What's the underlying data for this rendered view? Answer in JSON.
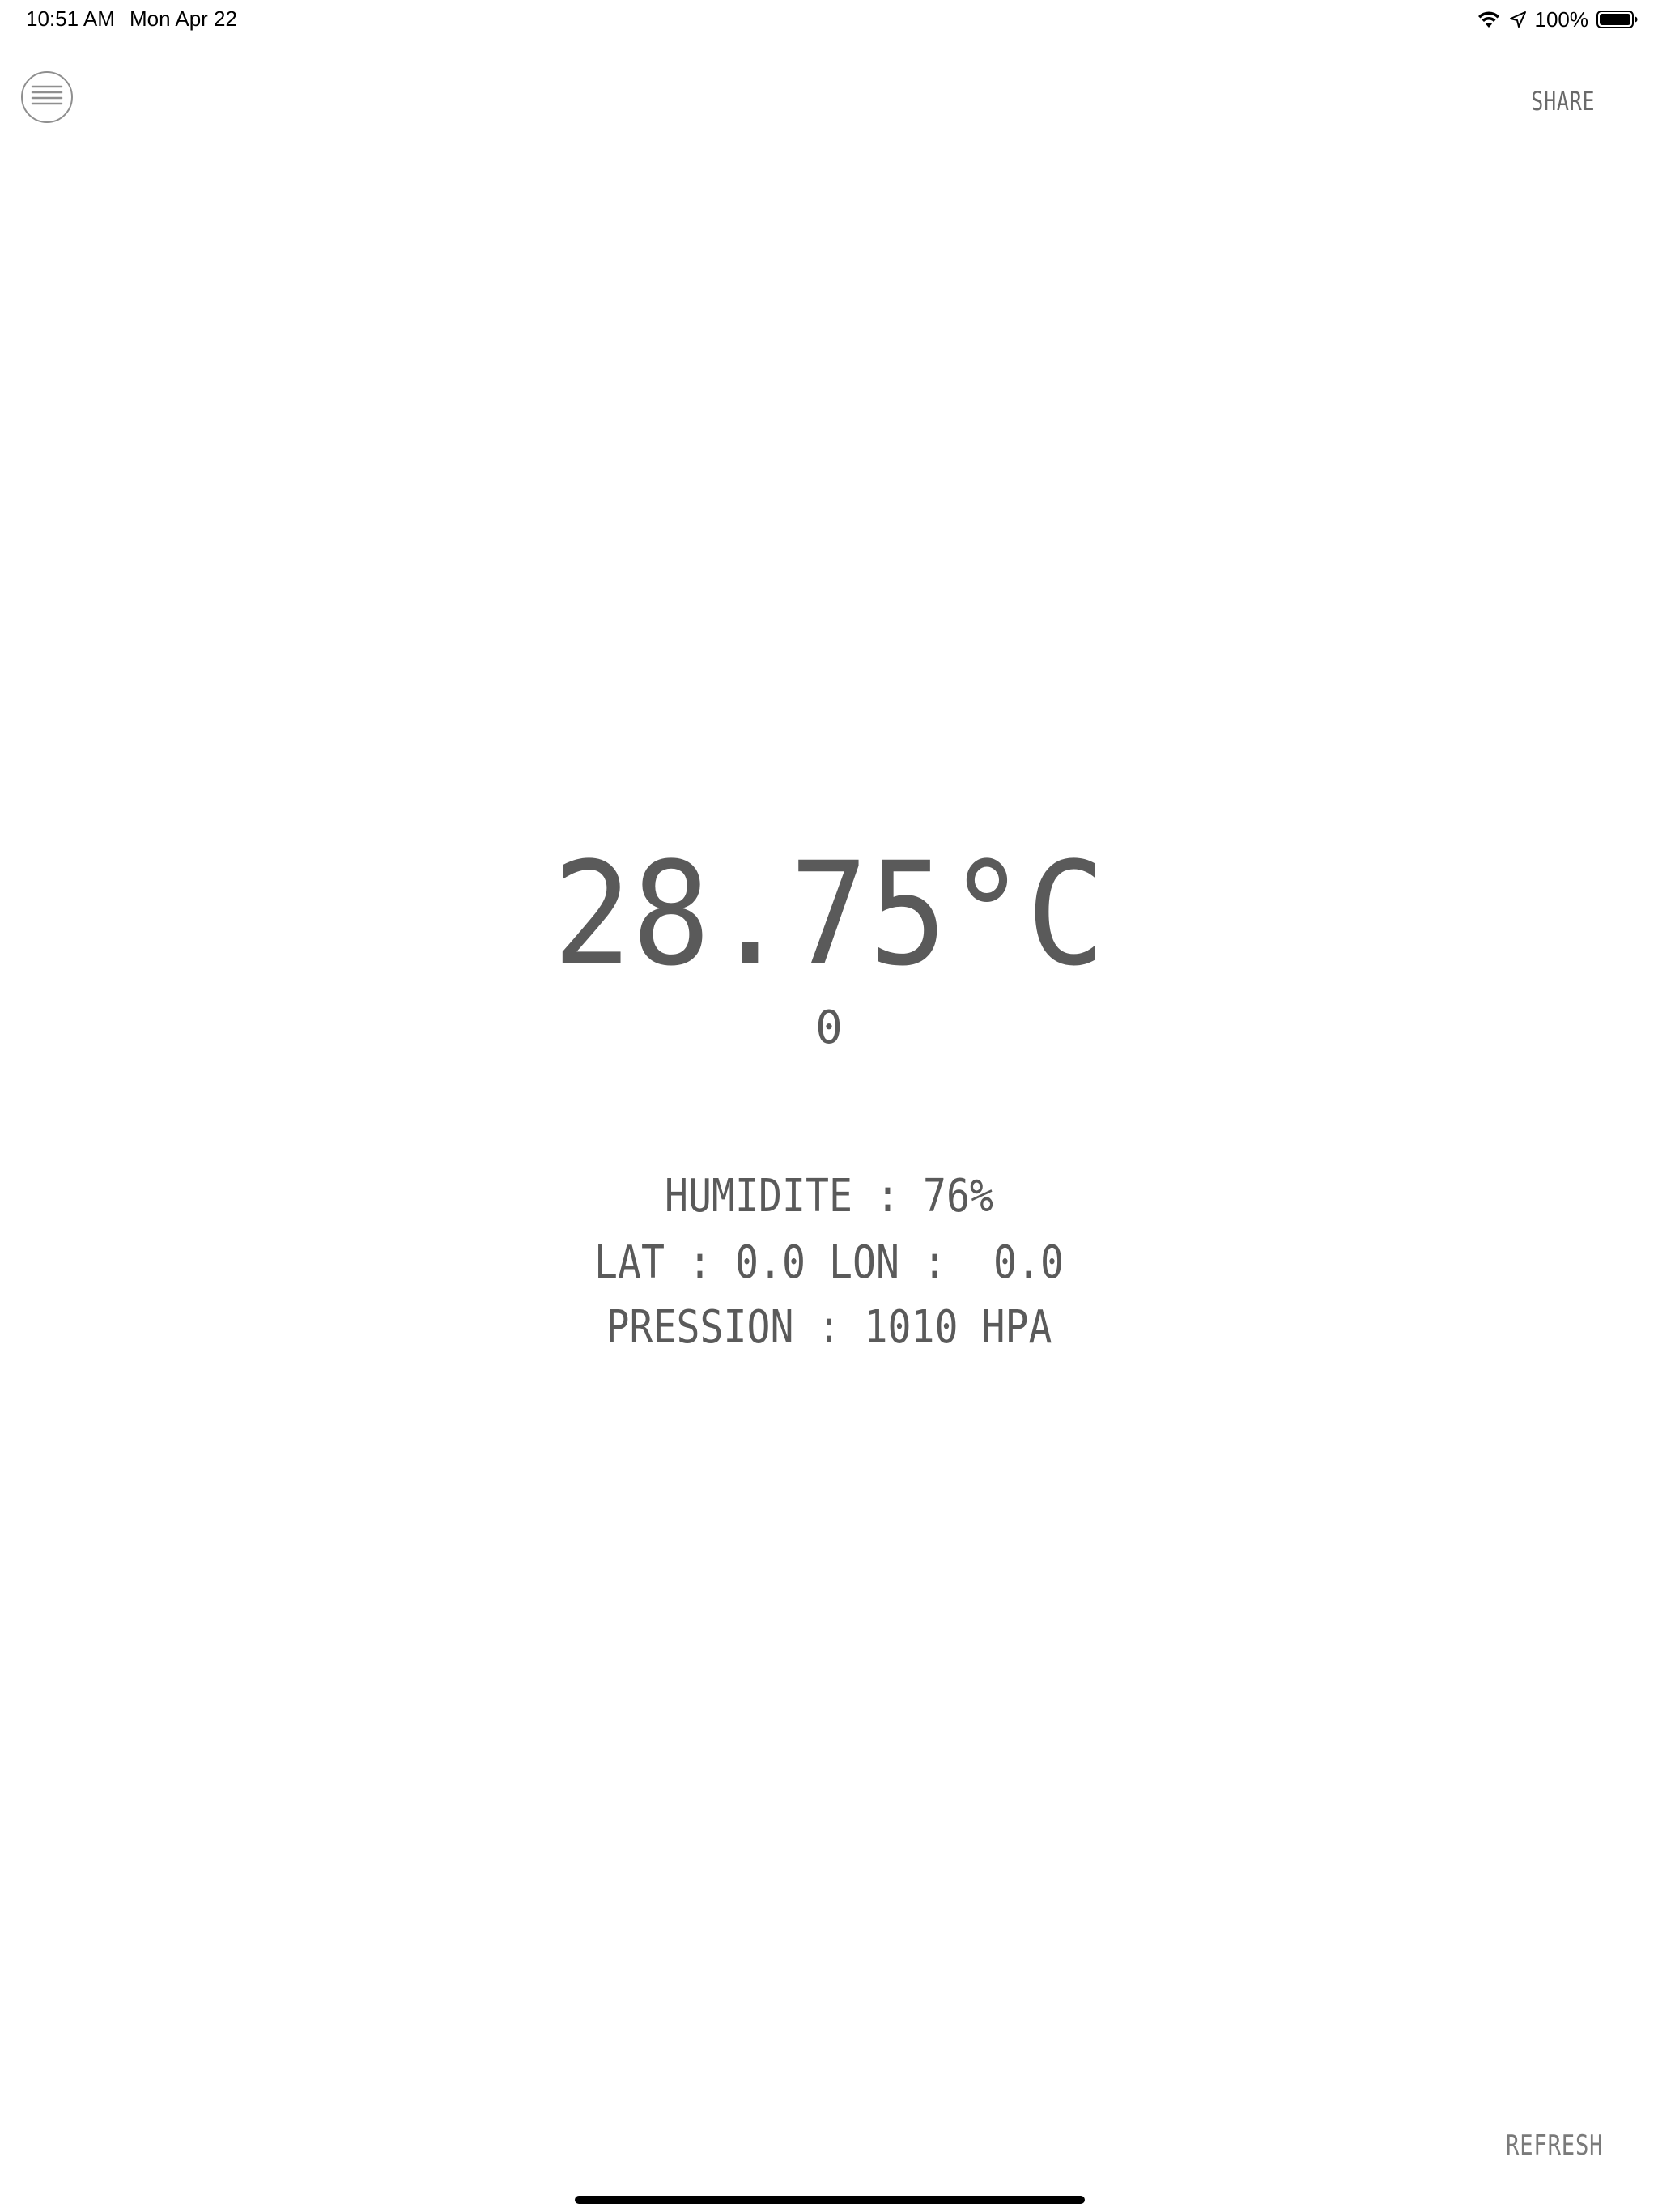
{
  "status_bar": {
    "time": "10:51 AM",
    "date": "Mon Apr 22",
    "battery_percent": "100%",
    "battery_level": 1.0,
    "icons": [
      "wifi-icon",
      "location-arrow-icon",
      "battery-icon"
    ]
  },
  "header": {
    "menu_icon": "hamburger-menu-icon",
    "share_label": "SHARE"
  },
  "weather": {
    "temperature": "28.75°C",
    "sub_value": "0",
    "humidity": "HUMIDITE : 76%",
    "coordinates": "LAT : 0.0 LON :  0.0",
    "pressure": "PRESSION : 1010 HPA"
  },
  "footer": {
    "refresh_label": "REFRESH"
  },
  "colors": {
    "text": "#5a5a5a",
    "button_text": "#6a6a6a",
    "background": "#ffffff"
  }
}
